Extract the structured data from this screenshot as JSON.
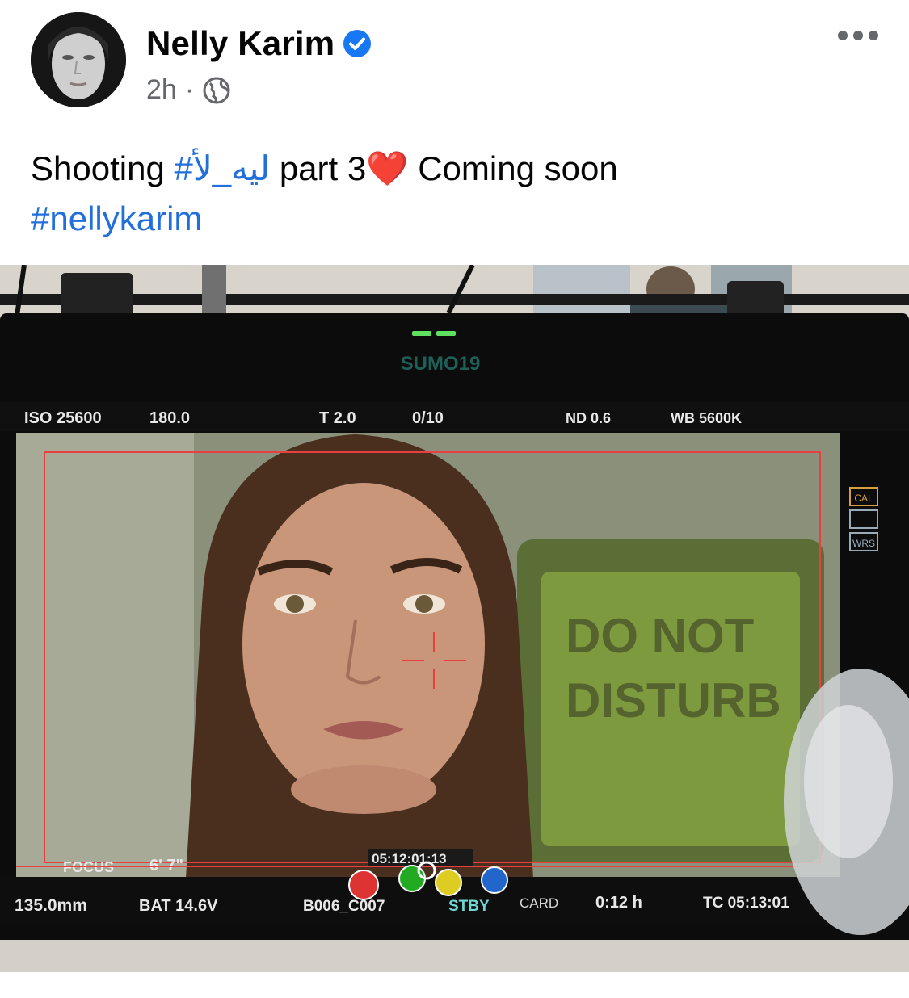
{
  "post": {
    "author": "Nelly Karim",
    "time": "2h",
    "separator": "·",
    "text_intro": "Shooting",
    "hashtag_arabic": "#ليه_لأ",
    "text_mid": "part 3",
    "heart": "❤️",
    "text_end": "Coming soon",
    "hashtag_name": "#nellykarim"
  },
  "icons": {
    "verified": "verified-badge-icon",
    "audience": "globe-icon",
    "more": "more-options-icon"
  },
  "colors": {
    "hashtag": "#216fdb",
    "verified": "#1877f2",
    "meta": "#65676b"
  },
  "monitor": {
    "brand": "SUMO19",
    "top_bar": {
      "iso": "ISO 25600",
      "shutter": "180.0",
      "iris": "T 2.0",
      "frame": "0/10",
      "nd": "ND 0.6",
      "wb": "WB 5600K"
    },
    "side_buttons": [
      "CAL",
      "WRS"
    ],
    "focus_label": "FOCUS",
    "focus_distance": "6' 7\"",
    "timecode_top": "05:12:01:13",
    "lens": "135.0mm",
    "battery": "BAT 14.6V",
    "clip": "B006_C007",
    "status": "STBY",
    "card_label": "CARD",
    "card_remaining": "0:12 h",
    "timecode_bottom": "TC 05:13:01"
  }
}
